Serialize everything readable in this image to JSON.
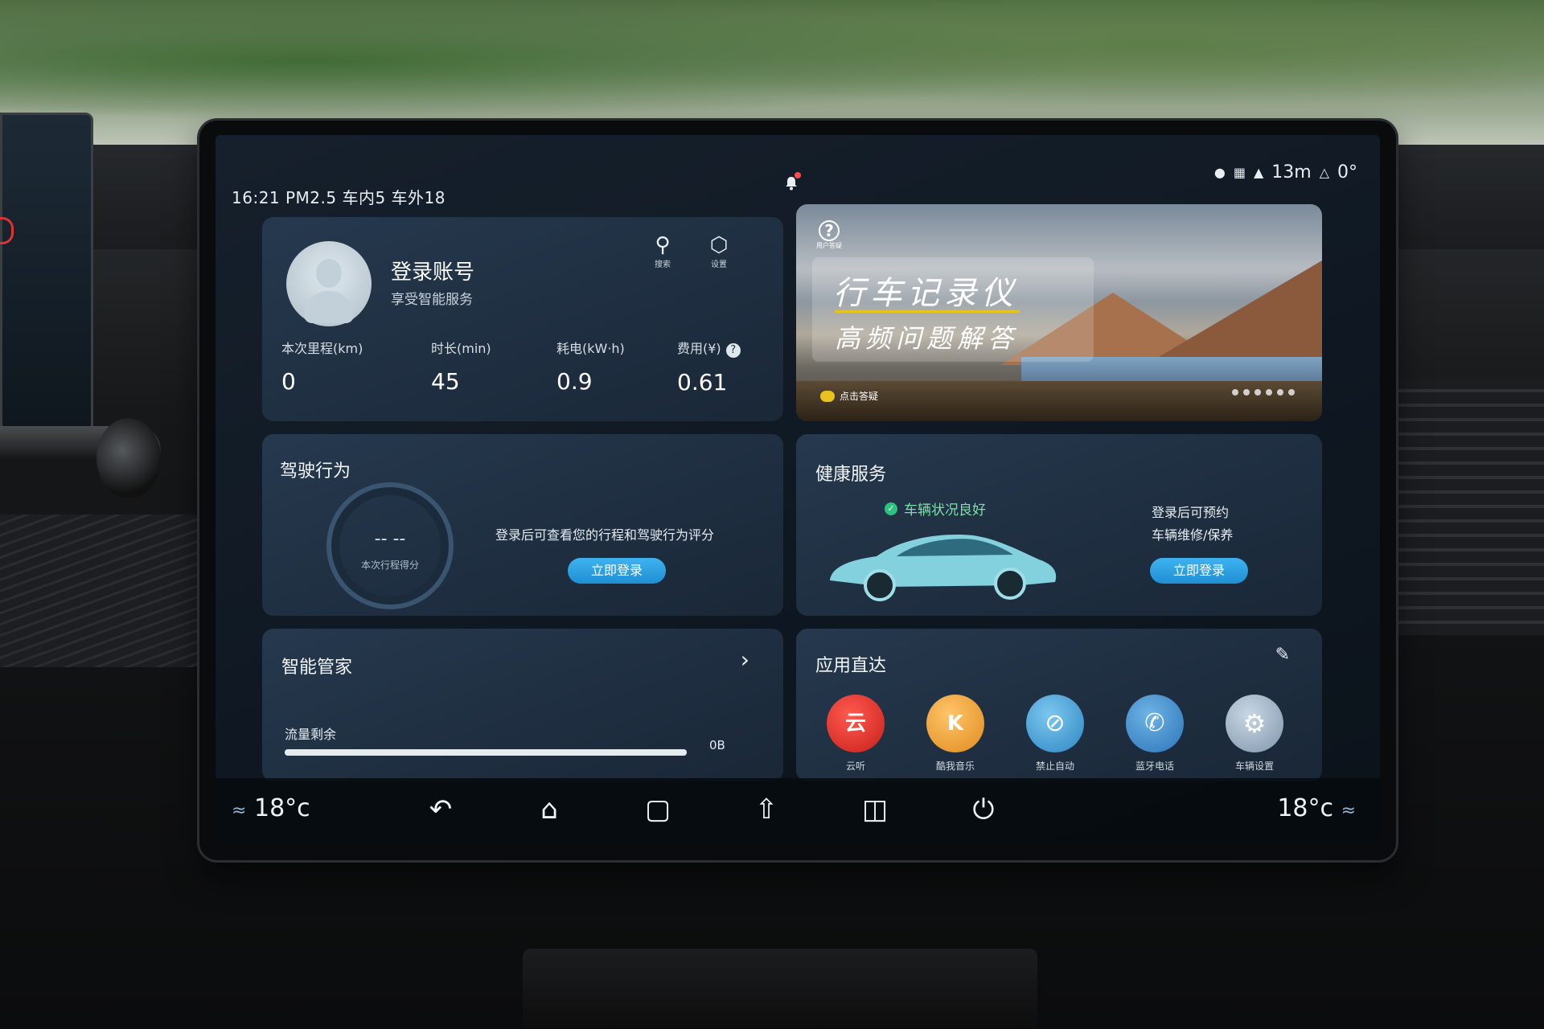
{
  "statusbar": {
    "left": "16:21 PM2.5 车内5 车外18",
    "right_text": "13m",
    "right_angle": "0°"
  },
  "account": {
    "title": "登录账号",
    "subtitle": "享受智能服务",
    "search_label": "搜索",
    "settings_label": "设置",
    "stats": [
      {
        "label": "本次里程(km)",
        "value": "0"
      },
      {
        "label": "时长(min)",
        "value": "45"
      },
      {
        "label": "耗电(kW·h)",
        "value": "0.9"
      },
      {
        "label": "费用(¥)",
        "value": "0.61"
      }
    ]
  },
  "banner": {
    "title": "行车记录仪",
    "subtitle": "高频问题解答",
    "help_label": "用户答疑",
    "tag": "点击答疑",
    "page_count": 6
  },
  "driving": {
    "title": "驾驶行为",
    "score": "-- --",
    "score_label": "本次行程得分",
    "message": "登录后可查看您的行程和驾驶行为评分",
    "login_button": "立即登录"
  },
  "health": {
    "title": "健康服务",
    "status": "车辆状况良好",
    "note_line1": "登录后可预约",
    "note_line2": "车辆维修/保养",
    "login_button": "立即登录"
  },
  "butler": {
    "title": "智能管家",
    "flow_label": "流量剩余",
    "flow_value": "0B",
    "flow_fraction": 1.0
  },
  "apps": {
    "title": "应用直达",
    "items": [
      {
        "name": "云听",
        "icon": "yunting-icon",
        "color": "#e8322b"
      },
      {
        "name": "酷我音乐",
        "icon": "kuwo-icon",
        "color": "#f2a33a"
      },
      {
        "name": "禁止自动",
        "icon": "blocked-icon",
        "color": "#4aa3d6"
      },
      {
        "name": "蓝牙电话",
        "icon": "phone-icon",
        "color": "#3e8fcf"
      },
      {
        "name": "车辆设置",
        "icon": "car-settings-icon",
        "color": "#8fa6bd"
      }
    ]
  },
  "navbar": {
    "temp_left": "18°c",
    "temp_right": "18°c"
  },
  "colors": {
    "accent": "#2ba3e6",
    "ok_green": "#2ec27e",
    "card_bg": "#233448"
  }
}
